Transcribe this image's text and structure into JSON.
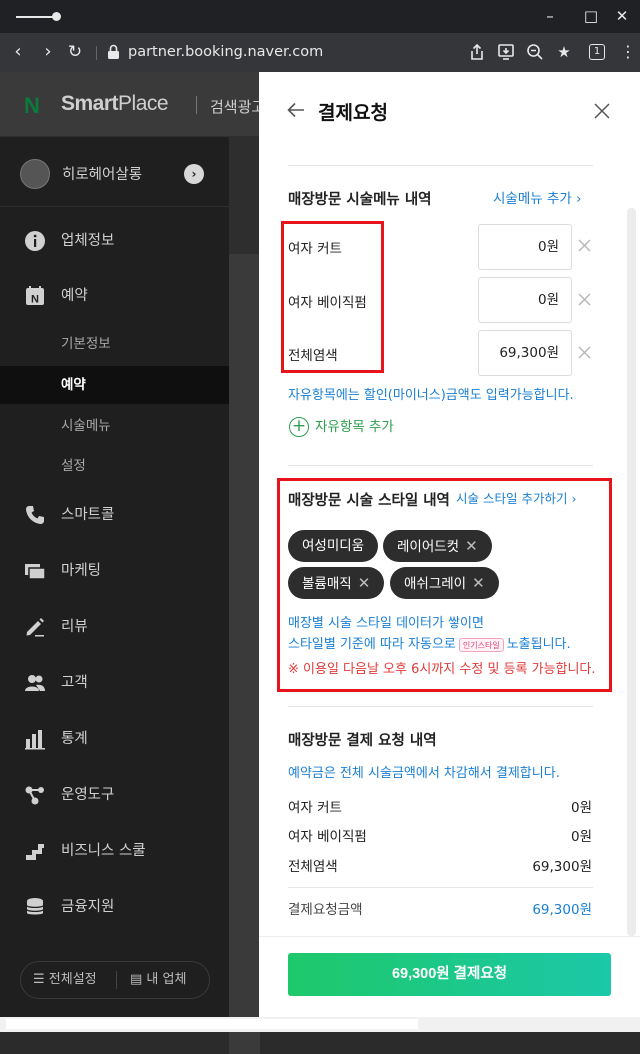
{
  "browser": {
    "url": "partner.booking.naver.com",
    "tab_count": "1"
  },
  "header": {
    "logo_mark": "N",
    "logo_text_bold": "Smart",
    "logo_text_light": "Place",
    "tab": "검색광고"
  },
  "sidebar": {
    "shop_name": "히로헤어살롱",
    "items": [
      {
        "label": "업체정보",
        "icon": "info-icon"
      },
      {
        "label": "예약",
        "icon": "calendar-n-icon"
      },
      {
        "label": "스마트콜",
        "icon": "phone-icon"
      },
      {
        "label": "마케팅",
        "icon": "marketing-icon"
      },
      {
        "label": "리뷰",
        "icon": "pencil-icon"
      },
      {
        "label": "고객",
        "icon": "people-icon"
      },
      {
        "label": "통계",
        "icon": "chart-icon"
      },
      {
        "label": "운영도구",
        "icon": "share-icon"
      },
      {
        "label": "비즈니스 스쿨",
        "icon": "steps-icon"
      },
      {
        "label": "금융지원",
        "icon": "coins-icon"
      }
    ],
    "sub_items": [
      "기본정보",
      "예약",
      "시술메뉴",
      "설정"
    ],
    "active_sub": "예약",
    "footer": {
      "all_settings": "전체설정",
      "my_business": "내 업체"
    }
  },
  "panel": {
    "title": "결제요청",
    "menu_section": {
      "title": "매장방문 시술메뉴 내역",
      "add_link": "시술메뉴 추가",
      "rows": [
        {
          "label": "여자 커트",
          "price": "0원"
        },
        {
          "label": "여자 베이직펌",
          "price": "0원"
        },
        {
          "label": "전체염색",
          "price": "69,300원"
        }
      ],
      "note": "자유항목에는 할인(마이너스)금액도 입력가능합니다.",
      "add_free": "자유항목 추가"
    },
    "style_section": {
      "title": "매장방문 시술 스타일 내역",
      "add_link": "시술 스타일 추가하기",
      "chips": [
        {
          "label": "여성미디움",
          "removable": false
        },
        {
          "label": "레이어드컷",
          "removable": true
        },
        {
          "label": "볼륨매직",
          "removable": true
        },
        {
          "label": "애쉬그레이",
          "removable": true
        }
      ],
      "note_line1": "매장별 시술 스타일 데이터가 쌓이면",
      "note_line2_before": "스타일별 기준에 따라 자동으로",
      "note_badge": "인기스타일",
      "note_line2_after": "노출됩니다.",
      "warning": "※ 이용일 다음날 오후 6시까지 수정 및 등록 가능합니다."
    },
    "summary_section": {
      "title": "매장방문 결제 요청 내역",
      "note": "예약금은 전체 시술금액에서 차감해서 결제합니다.",
      "rows": [
        {
          "label": "여자 커트",
          "value": "0원"
        },
        {
          "label": "여자 베이직펌",
          "value": "0원"
        },
        {
          "label": "전체염색",
          "value": "69,300원"
        }
      ],
      "total_label": "결제요청금액",
      "total_value": "69,300원"
    },
    "pay_button": "69,300원 결제요청"
  },
  "colors": {
    "accent_blue": "#1a7fd4",
    "accent_green": "#2f9e4e",
    "warning_red": "#e13a3a",
    "highlight_red": "#e8141c",
    "pay_gradient_start": "#1ec86a",
    "pay_gradient_end": "#1bc8a8"
  }
}
